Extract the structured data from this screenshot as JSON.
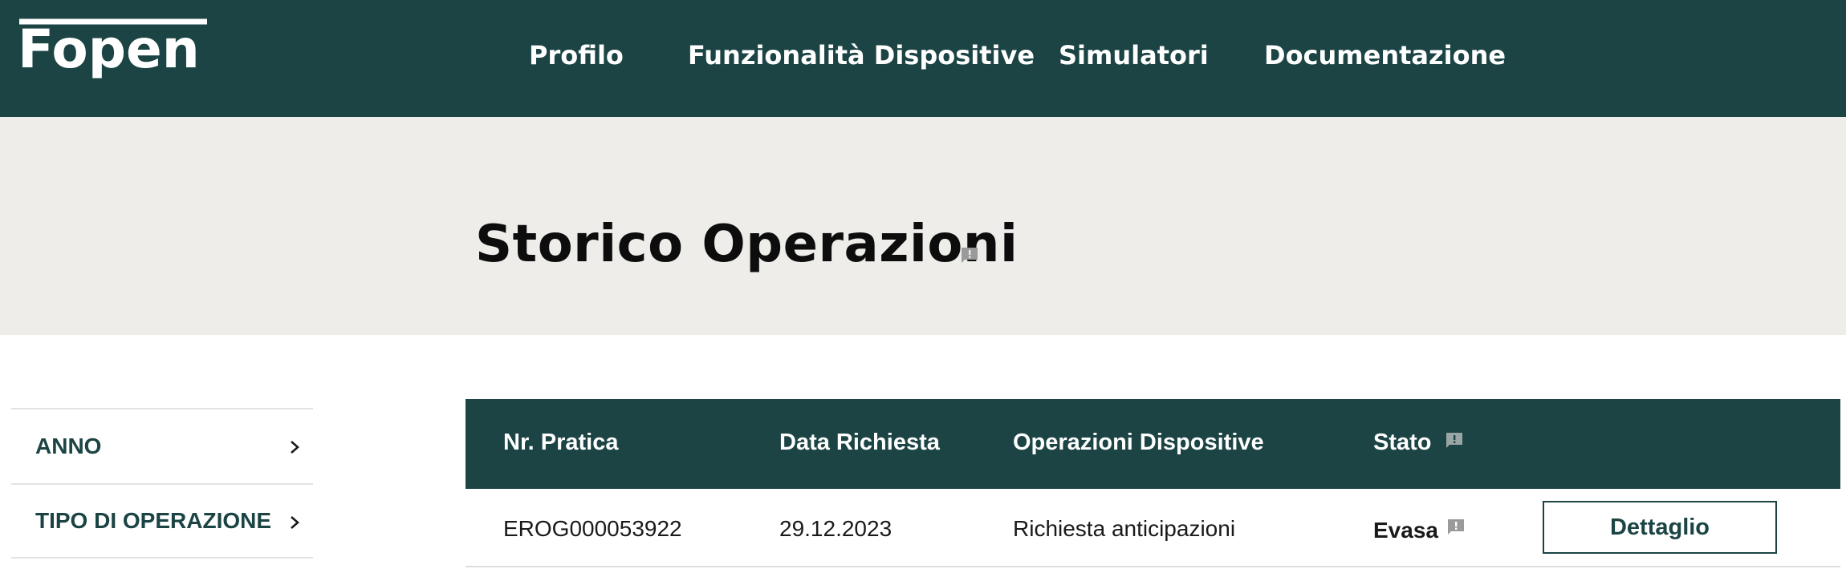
{
  "brand": {
    "logo_text": "Fopen",
    "header_color": "#1c4444"
  },
  "nav": {
    "items": [
      {
        "label": "Profilo"
      },
      {
        "label": "Funzionalità Dispositive"
      },
      {
        "label": "Simulatori"
      },
      {
        "label": "Documentazione"
      }
    ]
  },
  "page": {
    "title": "Storico Operazioni",
    "band_color": "#efedea"
  },
  "sidebar": {
    "filters": [
      {
        "label": "ANNO",
        "icon": "chevron-right-icon"
      },
      {
        "label": "TIPO DI OPERAZIONE",
        "icon": "chevron-right-icon"
      }
    ]
  },
  "table": {
    "headers": {
      "number": "Nr. Pratica",
      "date": "Data Richiesta",
      "operation": "Operazioni Dispositive",
      "status": "Stato"
    },
    "rows": [
      {
        "number": "EROG000053922",
        "date": "29.12.2023",
        "operation": "Richiesta anticipazioni",
        "status": "Evasa",
        "action": "Dettaglio"
      }
    ]
  },
  "icons": {
    "feedback": "feedback-icon"
  }
}
